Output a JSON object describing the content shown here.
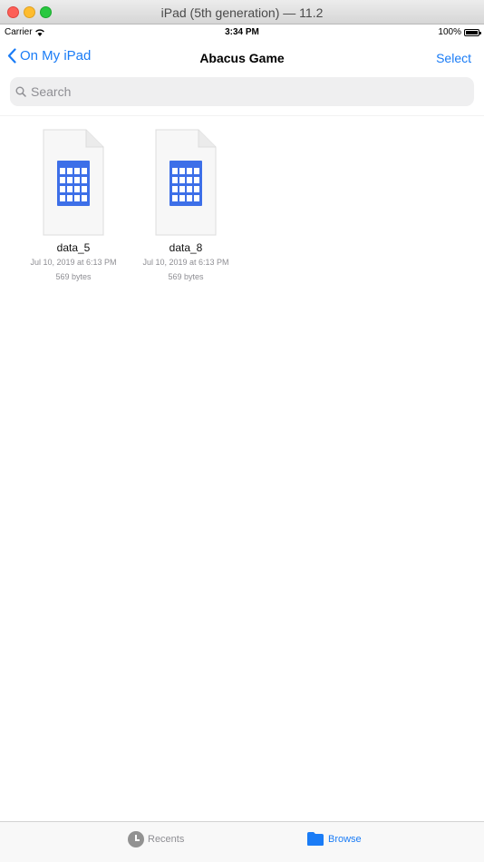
{
  "window": {
    "title": "iPad (5th generation) — 11.2"
  },
  "status_bar": {
    "carrier": "Carrier",
    "time": "3:34 PM",
    "battery": "100%"
  },
  "nav": {
    "back_label": "On My iPad",
    "title": "Abacus Game",
    "select_label": "Select"
  },
  "search": {
    "placeholder": "Search"
  },
  "files": [
    {
      "name": "data_5",
      "date": "Jul 10, 2019 at 6:13 PM",
      "size": "569 bytes",
      "icon": "spreadsheet-icon"
    },
    {
      "name": "data_8",
      "date": "Jul 10, 2019 at 6:13 PM",
      "size": "569 bytes",
      "icon": "spreadsheet-icon"
    }
  ],
  "tab_bar": {
    "recents_label": "Recents",
    "browse_label": "Browse",
    "active": "Browse"
  },
  "colors": {
    "accent": "#1a7cf6",
    "file_icon": "#3d6fe8"
  }
}
